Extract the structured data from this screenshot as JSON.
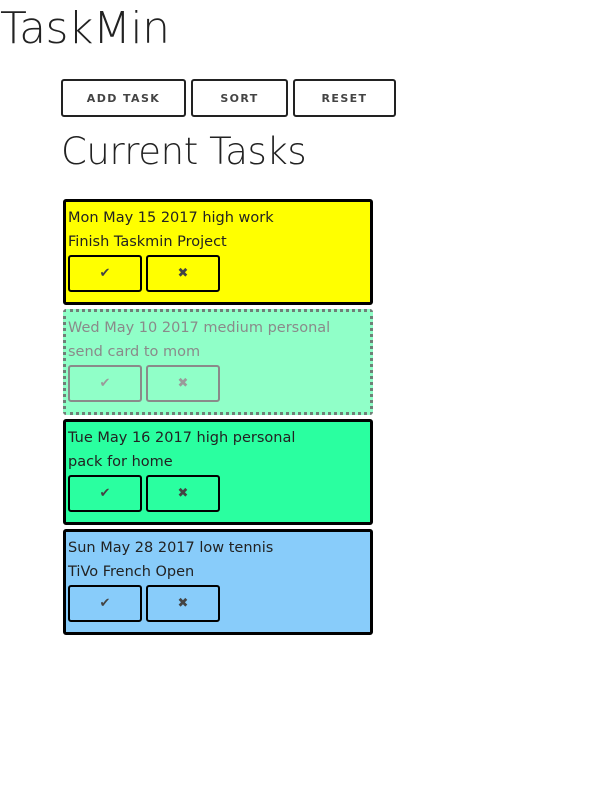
{
  "app": {
    "title": "TaskMin"
  },
  "toolbar": {
    "add_label": "ADD TASK",
    "sort_label": "SORT",
    "reset_label": "RESET"
  },
  "main": {
    "heading": "Current Tasks"
  },
  "icons": {
    "complete": "✔",
    "delete": "✖"
  },
  "colors": {
    "task_0": "#ffff00",
    "task_1": "#90ffc8",
    "task_2": "#2affa0",
    "task_3": "#88ccfa"
  },
  "tasks": [
    {
      "meta": "Mon May 15 2017 high work",
      "description": "Finish Taskmin Project",
      "done": false
    },
    {
      "meta": "Wed May 10 2017 medium personal",
      "description": "send card to mom",
      "done": true
    },
    {
      "meta": "Tue May 16 2017 high personal",
      "description": "pack for home",
      "done": false
    },
    {
      "meta": "Sun May 28 2017 low tennis",
      "description": "TiVo French Open",
      "done": false
    }
  ]
}
